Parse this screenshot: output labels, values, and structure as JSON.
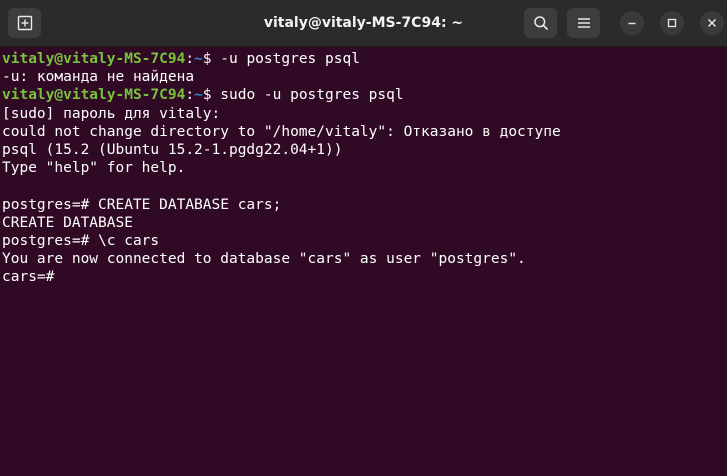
{
  "window": {
    "title": "vitaly@vitaly-MS-7C94: ~",
    "icons": {
      "new_tab": "new-tab-icon",
      "search": "search-icon",
      "menu": "hamburger-menu-icon",
      "minimize": "minimize-icon",
      "maximize": "maximize-icon",
      "close": "close-icon"
    }
  },
  "colors": {
    "background": "#300a24",
    "titlebar": "#2b2b2b",
    "prompt_user": "#78c23c",
    "prompt_path": "#2f7fd7",
    "text": "#ffffff"
  },
  "terminal": {
    "prompt1": {
      "user": "vitaly@vitaly-MS-7C94",
      "sep": ":",
      "path": "~",
      "cmd": "$ -u postgres psql"
    },
    "line2": "-u: команда не найдена",
    "prompt2": {
      "user": "vitaly@vitaly-MS-7C94",
      "sep": ":",
      "path": "~",
      "cmd": "$ sudo -u postgres psql"
    },
    "output": [
      "[sudo] пароль для vitaly:",
      "could not change directory to \"/home/vitaly\": Отказано в доступе",
      "psql (15.2 (Ubuntu 15.2-1.pgdg22.04+1))",
      "Type \"help\" for help.",
      "",
      "postgres=# CREATE DATABASE cars;",
      "CREATE DATABASE",
      "postgres=# \\c cars",
      "You are now connected to database \"cars\" as user \"postgres\".",
      "cars=#"
    ]
  }
}
